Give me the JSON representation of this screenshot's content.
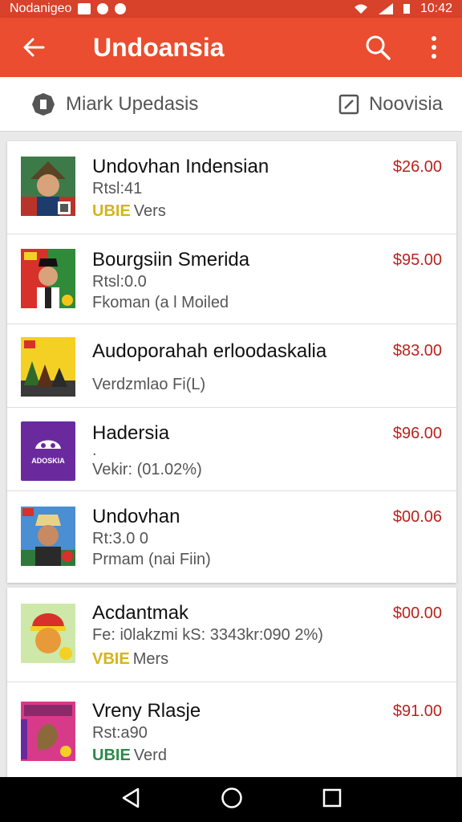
{
  "status_bar": {
    "left_text": "Nodanigeo",
    "time": "10:42"
  },
  "app_bar": {
    "title": "Undoansia"
  },
  "sub_bar": {
    "left_label": "Miark Upedasis",
    "right_label": "Noovisia"
  },
  "items": [
    {
      "title": "Undovhan Indensian",
      "sub": "Rtsl:41",
      "badge": "UBIE",
      "badge_text": "Vers",
      "price": "$26.00"
    },
    {
      "title": "Bourgsiin Smerida",
      "sub": "Rtsl:0.0",
      "line2": "Fkoman (a l Moiled",
      "price": "$95.00"
    },
    {
      "title": "Audoporahah erloodaskalia",
      "sub": "",
      "line2": "Verdzmlao Fi(L)",
      "price": "$83.00"
    },
    {
      "title": "Hadersia",
      "sub": ".",
      "line2": "Vekir: (01.02%)",
      "price": "$96.00"
    },
    {
      "title": "Undovhan",
      "sub": "Rt:3.0 0",
      "line2": "Prmam (nai Fiin)",
      "price": "$00.06"
    },
    {
      "title": "Acdantmak",
      "sub": "Fe: i0lakzmi kS: 3343kr:090 2%)",
      "badge": "VBIE",
      "badge_text": "Mers",
      "price": "$00.00"
    },
    {
      "title": "Vreny Rlasje",
      "sub": "Rst:a90",
      "badge": "UBIE",
      "badge_text": "Verd",
      "price": "$91.00"
    }
  ],
  "thumb_texts": {
    "item4": "ADOSKIA"
  },
  "colors": {
    "accent": "#ea4d2f",
    "price": "#b8231e",
    "badge_yellow": "#d4b51a",
    "badge_green": "#2b8a4a"
  }
}
